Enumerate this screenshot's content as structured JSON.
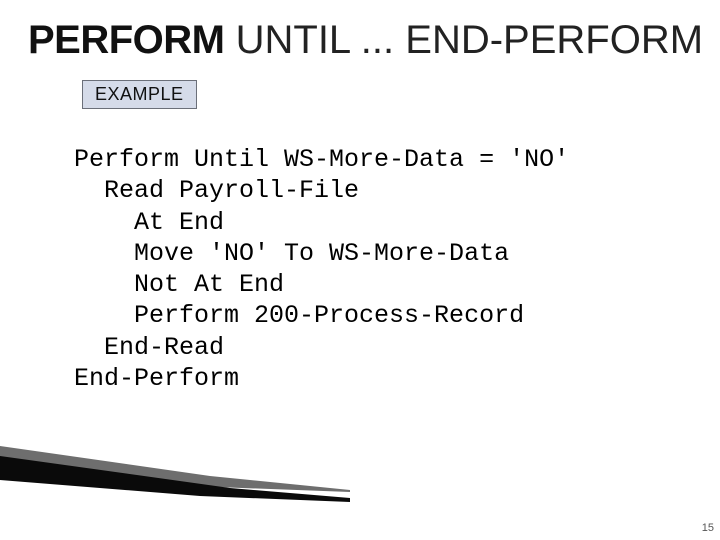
{
  "title": {
    "lead": "PERFORM",
    "rest": " UNTIL ... END-PERFORM"
  },
  "badge": {
    "label": "EXAMPLE"
  },
  "code": {
    "l1": "Perform Until WS-More-Data = 'NO'",
    "l2": "  Read Payroll-File",
    "l3": "    At End",
    "l4": "    Move 'NO' To WS-More-Data",
    "l5": "    Not At End",
    "l6": "    Perform 200-Process-Record",
    "l7": "  End-Read",
    "l8": "End-Perform"
  },
  "page": {
    "number": "15"
  }
}
